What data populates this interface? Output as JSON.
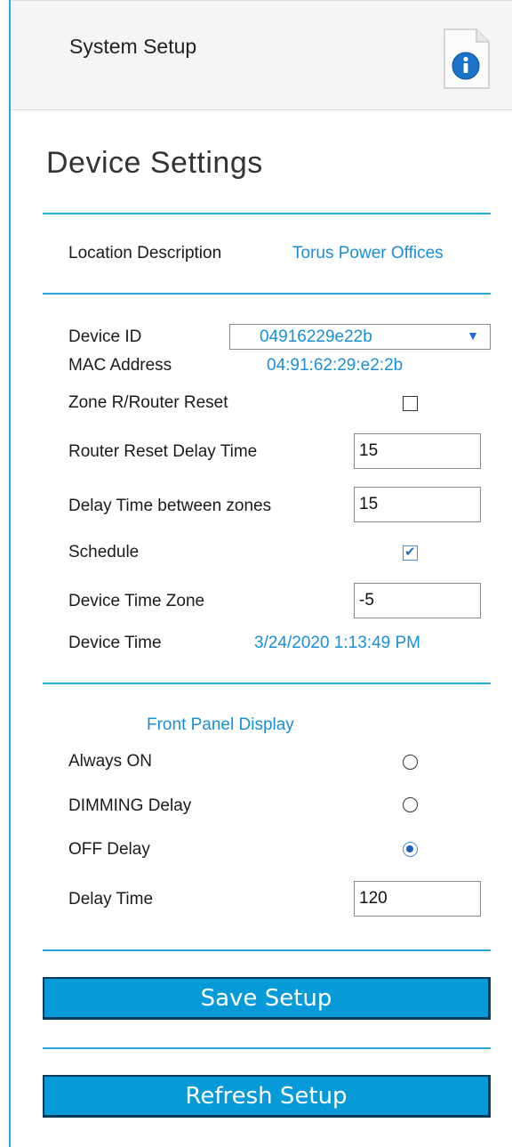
{
  "header": {
    "title": "System Setup",
    "info_icon": "info-document-icon"
  },
  "page": {
    "title": "Device Settings"
  },
  "location": {
    "label": "Location Description",
    "value": "Torus Power Offices"
  },
  "device": {
    "device_id_label": "Device ID",
    "device_id_selected": "04916229e22b",
    "mac_label": "MAC Address",
    "mac_value": "04:91:62:29:e2:2b",
    "zone_reset_label": "Zone R/Router Reset",
    "zone_reset_checked": false,
    "router_delay_label": "Router Reset Delay Time",
    "router_delay_value": "15",
    "zone_delay_label": "Delay Time between zones",
    "zone_delay_value": "15",
    "schedule_label": "Schedule",
    "schedule_checked": true,
    "timezone_label": "Device Time Zone",
    "timezone_value": "-5",
    "time_label": "Device Time",
    "time_value": "3/24/2020 1:13:49 PM"
  },
  "front_panel": {
    "heading": "Front Panel Display",
    "options": [
      {
        "label": "Always ON",
        "selected": false
      },
      {
        "label": "DIMMING Delay",
        "selected": false
      },
      {
        "label": "OFF Delay",
        "selected": true
      }
    ],
    "delay_label": "Delay Time",
    "delay_value": "120"
  },
  "actions": {
    "save_label": "Save Setup",
    "refresh_label": "Refresh Setup"
  },
  "colors": {
    "accent": "#29a8e0",
    "link_blue": "#1b8fd6",
    "button_bg": "#079ad9"
  }
}
